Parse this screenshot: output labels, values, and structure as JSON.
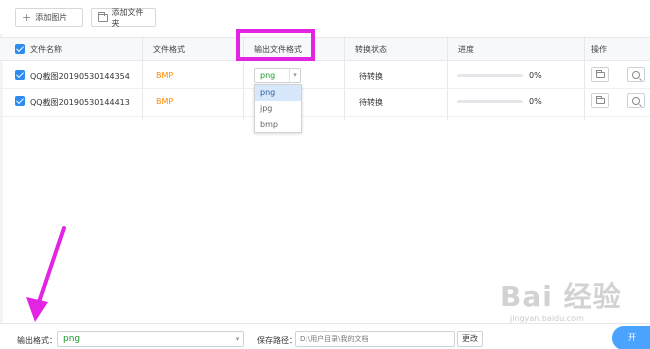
{
  "toolbar": {
    "add_image_label": "添加图片",
    "add_folder_label": "添加文件夹"
  },
  "table": {
    "headers": {
      "file_name": "文件名称",
      "file_format": "文件格式",
      "output_format": "输出文件格式",
      "convert_status": "转换状态",
      "progress": "进度",
      "actions": "操作"
    },
    "rows": [
      {
        "name": "QQ截图20190530144354",
        "format": "BMP",
        "output": "png",
        "status": "待转换",
        "progress_percent": 0,
        "progress_text": "0%"
      },
      {
        "name": "QQ截图20190530144413",
        "format": "BMP",
        "output": "png",
        "status": "待转换",
        "progress_percent": 0,
        "progress_text": "0%"
      }
    ]
  },
  "dropdown": {
    "options": [
      "png",
      "jpg",
      "bmp"
    ],
    "selected": "png"
  },
  "bottom": {
    "output_format_label": "输出格式：",
    "output_format_value": "png",
    "save_path_label": "保存路径：",
    "save_path_value": "D:\\用户目录\\我的文档",
    "change_label": "更改",
    "start_label": "开"
  },
  "watermark": {
    "logo_text": "Bai 经验",
    "url": "jingyan.baidu.com"
  },
  "colors": {
    "accent": "#2d8cf0",
    "format_orange": "#ff8a00",
    "output_green": "#1a9a2a",
    "highlight_magenta": "#e325e3"
  }
}
